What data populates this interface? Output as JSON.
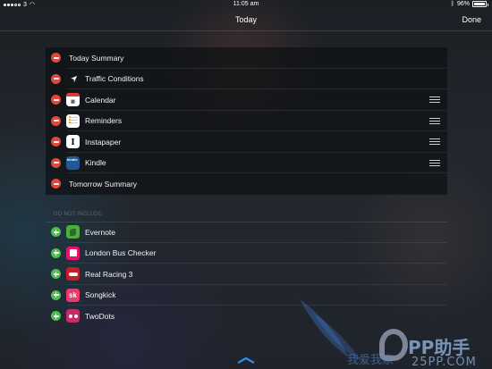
{
  "status_bar": {
    "carrier": "3",
    "time": "11:05 am",
    "battery_percent": "96%",
    "battery_level": 0.96
  },
  "nav": {
    "title": "Today",
    "done_label": "Done"
  },
  "included": [
    {
      "label": "Today Summary",
      "icon": "none",
      "reorder": false
    },
    {
      "label": "Traffic Conditions",
      "icon": "location-arrow-icon",
      "reorder": false
    },
    {
      "label": "Calendar",
      "icon": "calendar-app-icon",
      "reorder": true
    },
    {
      "label": "Reminders",
      "icon": "reminders-app-icon",
      "reorder": true
    },
    {
      "label": "Instapaper",
      "icon": "instapaper-app-icon",
      "icon_glyph": "I",
      "reorder": true
    },
    {
      "label": "Kindle",
      "icon": "kindle-app-icon",
      "icon_glyph": "kindle",
      "reorder": true
    },
    {
      "label": "Tomorrow Summary",
      "icon": "none",
      "reorder": false
    }
  ],
  "excluded_header": "DO NOT INCLUDE",
  "excluded": [
    {
      "label": "Evernote",
      "icon": "evernote-app-icon"
    },
    {
      "label": "London Bus Checker",
      "icon": "london-bus-checker-app-icon"
    },
    {
      "label": "Real Racing 3",
      "icon": "real-racing-app-icon"
    },
    {
      "label": "Songkick",
      "icon": "songkick-app-icon",
      "icon_glyph": "sk"
    },
    {
      "label": "TwoDots",
      "icon": "twodots-app-icon"
    }
  ],
  "watermark": {
    "logo_text": "PP助手",
    "site_text": "25PP.COM",
    "cn_text": "我爱我家"
  },
  "colors": {
    "remove": "#e5463c",
    "add": "#49c04a"
  }
}
